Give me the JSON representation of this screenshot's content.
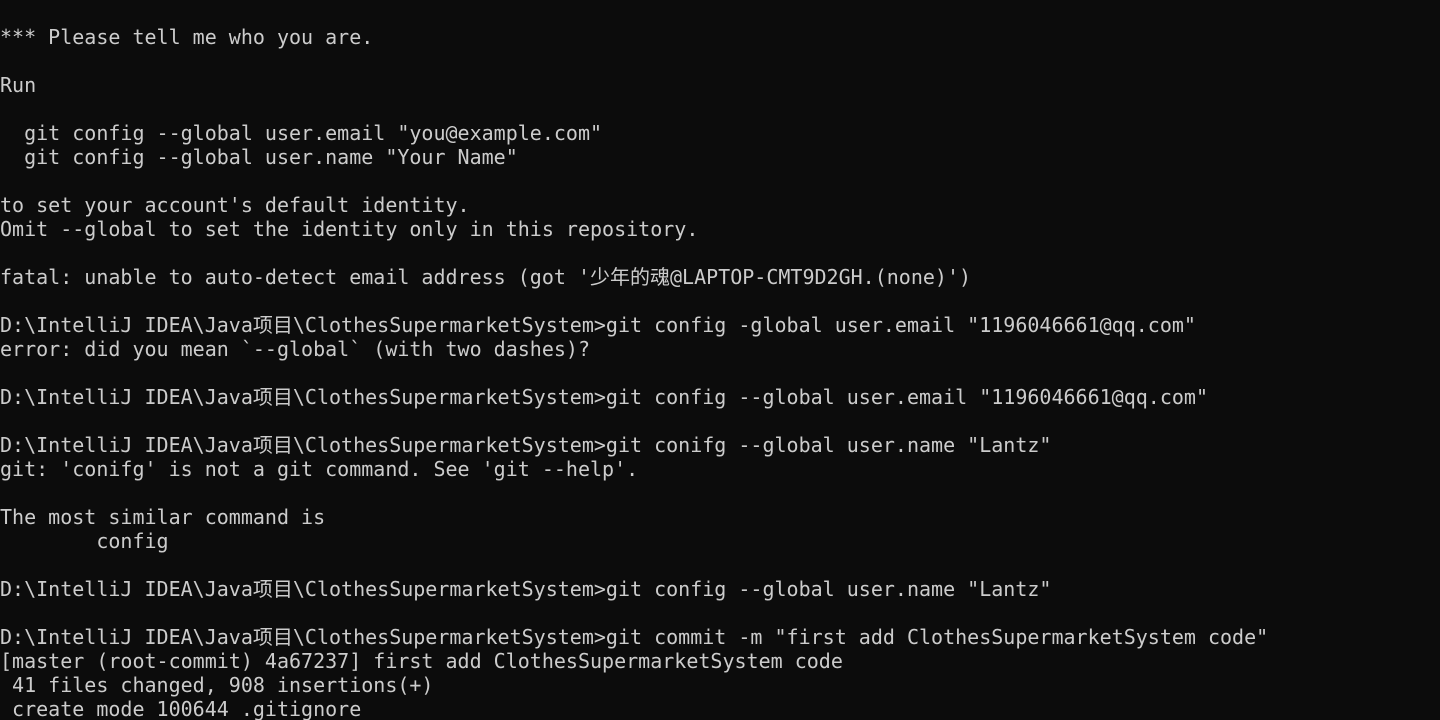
{
  "terminal": {
    "background": "#0c0c0c",
    "foreground": "#cccccc",
    "lines": [
      "*** Please tell me who you are.",
      "",
      "Run",
      "",
      "  git config --global user.email \"you@example.com\"",
      "  git config --global user.name \"Your Name\"",
      "",
      "to set your account's default identity.",
      "Omit --global to set the identity only in this repository.",
      "",
      "fatal: unable to auto-detect email address (got '少年的魂@LAPTOP-CMT9D2GH.(none)')",
      "",
      "D:\\IntelliJ IDEA\\Java项目\\ClothesSupermarketSystem>git config -global user.email \"1196046661@qq.com\"",
      "error: did you mean `--global` (with two dashes)?",
      "",
      "D:\\IntelliJ IDEA\\Java项目\\ClothesSupermarketSystem>git config --global user.email \"1196046661@qq.com\"",
      "",
      "D:\\IntelliJ IDEA\\Java项目\\ClothesSupermarketSystem>git conifg --global user.name \"Lantz\"",
      "git: 'conifg' is not a git command. See 'git --help'.",
      "",
      "The most similar command is",
      "        config",
      "",
      "D:\\IntelliJ IDEA\\Java项目\\ClothesSupermarketSystem>git config --global user.name \"Lantz\"",
      "",
      "D:\\IntelliJ IDEA\\Java项目\\ClothesSupermarketSystem>git commit -m \"first add ClothesSupermarketSystem code\"",
      "[master (root-commit) 4a67237] first add ClothesSupermarketSystem code",
      " 41 files changed, 908 insertions(+)",
      " create mode 100644 .gitignore"
    ]
  }
}
